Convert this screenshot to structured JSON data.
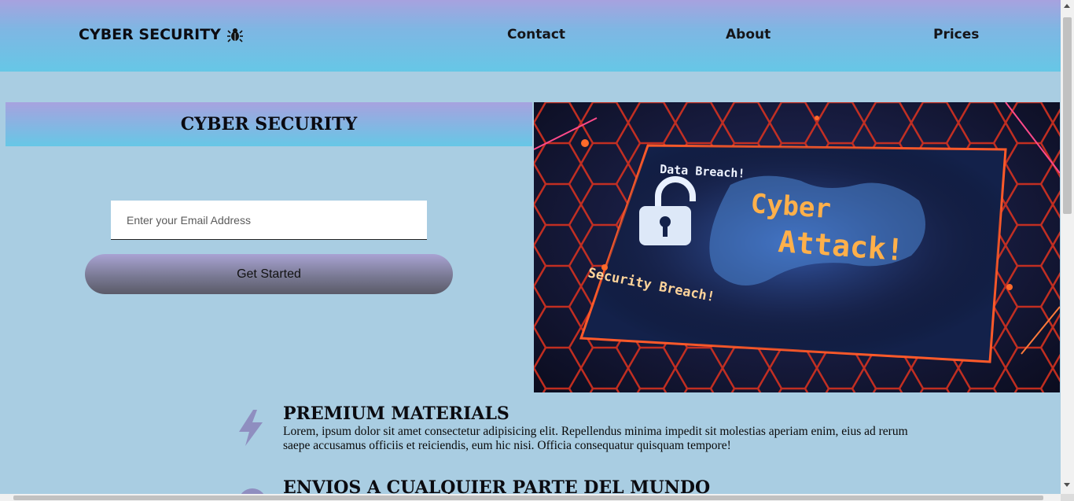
{
  "navbar": {
    "brand": "CYBER SECURITY",
    "brand_icon": "bug-icon",
    "links": [
      "Contact",
      "About",
      "Prices"
    ]
  },
  "hero": {
    "title": "CYBER SECURITY",
    "email_placeholder": "Enter your Email Address",
    "cta_label": "Get Started",
    "image": {
      "texts": [
        "Data Breach!",
        "Cyber",
        "Attack!",
        "Security Breach!"
      ],
      "icon": "padlock-icon"
    }
  },
  "features": [
    {
      "icon": "lightning-icon",
      "title": "PREMIUM MATERIALS",
      "text": "Lorem, ipsum dolor sit amet consectetur adipisicing elit. Repellendus minima impedit sit molestias aperiam enim, eius ad rerum saepe accusamus officiis et reiciendis, eum hic nisi. Officia consequatur quisquam tempore!"
    },
    {
      "icon": "circle-icon",
      "title": "ENVIOS A CUALQUIER PARTE DEL MUNDO",
      "text": ""
    }
  ],
  "colors": {
    "background": "#a9cde2",
    "nav_gradient_top": "#a7a2df",
    "nav_gradient_bottom": "#66c7e6",
    "icon_color": "#8f8ec0"
  }
}
